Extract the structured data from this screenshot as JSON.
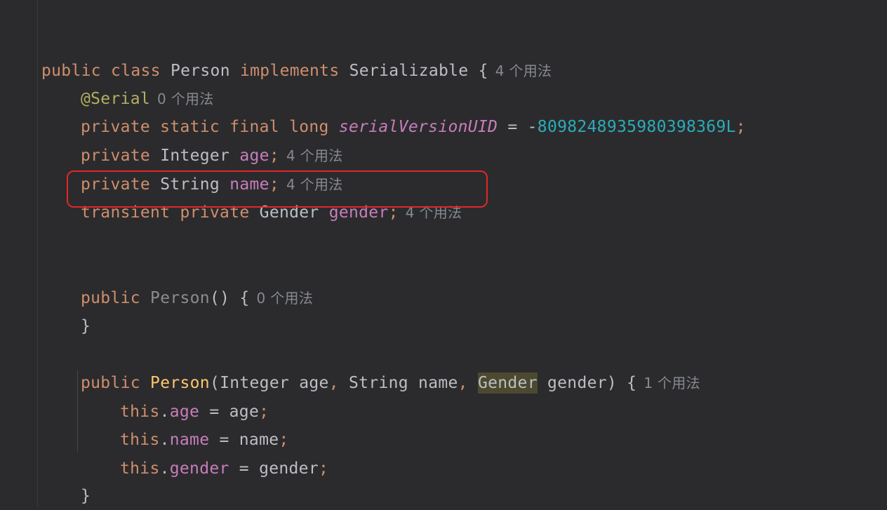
{
  "editor": {
    "language": "Java",
    "class_decl": {
      "kw1": "public",
      "kw2": "class",
      "name": "Person",
      "kw3": "implements",
      "iface": "Serializable",
      "brace": "{",
      "hint": "4 个用法"
    },
    "serial_annotation": {
      "text": "@Serial",
      "hint": "0 个用法"
    },
    "serial_field": {
      "mods": "private static final long",
      "name": "serialVersionUID",
      "eq": " = -",
      "value": "8098248935980398369L",
      "semi": ";"
    },
    "age_field": {
      "mod": "private",
      "type": "Integer",
      "name": "age",
      "semi": ";",
      "hint": "4 个用法"
    },
    "name_field": {
      "mod": "private",
      "type": "String",
      "name": "name",
      "semi": ";",
      "hint": "4 个用法"
    },
    "gender_field": {
      "mods": "transient private",
      "type": "Gender",
      "name": "gender",
      "semi": ";",
      "hint": "4 个用法"
    },
    "ctor0": {
      "mod": "public",
      "name": "Person",
      "rest": "() {",
      "hint": "0 个用法",
      "close": "}"
    },
    "ctor1": {
      "mod": "public",
      "name": "Person",
      "p1": "(Integer age",
      "comma1": ",",
      "p2": " String name",
      "comma2": ",",
      "p3type": "Gender",
      "p3rest": " gender) {",
      "hint": "1 个用法",
      "close": "}"
    },
    "assign1": {
      "this": "this",
      "dot": ".",
      "field": "age",
      "rest": " = age",
      "semi": ";"
    },
    "assign2": {
      "this": "this",
      "dot": ".",
      "field": "name",
      "rest": " = name",
      "semi": ";"
    },
    "assign3": {
      "this": "this",
      "dot": ".",
      "field": "gender",
      "rest": " = gender",
      "semi": ";"
    }
  }
}
